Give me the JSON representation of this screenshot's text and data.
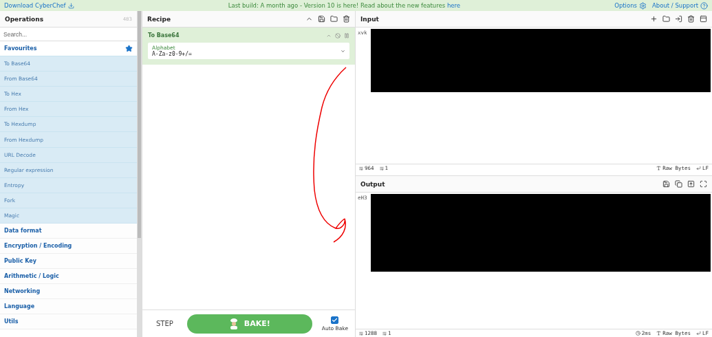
{
  "top_bar": {
    "download": "Download CyberChef",
    "notice": "Last build: A month ago - Version 10 is here! Read about the new features ",
    "notice_link": "here",
    "options": "Options",
    "about": "About / Support"
  },
  "operations": {
    "title": "Operations",
    "count": "483",
    "search_placeholder": "Search...",
    "categories": [
      {
        "name": "Favourites",
        "expanded": true,
        "items": [
          "To Base64",
          "From Base64",
          "To Hex",
          "From Hex",
          "To Hexdump",
          "From Hexdump",
          "URL Decode",
          "Regular expression",
          "Entropy",
          "Fork",
          "Magic"
        ]
      },
      {
        "name": "Data format",
        "expanded": false
      },
      {
        "name": "Encryption / Encoding",
        "expanded": false
      },
      {
        "name": "Public Key",
        "expanded": false
      },
      {
        "name": "Arithmetic / Logic",
        "expanded": false
      },
      {
        "name": "Networking",
        "expanded": false
      },
      {
        "name": "Language",
        "expanded": false
      },
      {
        "name": "Utils",
        "expanded": false
      }
    ]
  },
  "recipe": {
    "title": "Recipe",
    "operation": {
      "name": "To Base64",
      "field_label": "Alphabet",
      "field_value": "A-Za-z0-9+/="
    },
    "step": "STEP",
    "bake": "BAKE!",
    "auto_bake": {
      "label": "Auto Bake",
      "checked": true
    }
  },
  "input": {
    "title": "Input",
    "value": "xvk",
    "status": {
      "length": "964",
      "lines": "1",
      "encoding": "Raw Bytes",
      "eol": "LF"
    }
  },
  "output": {
    "title": "Output",
    "value": "eH3",
    "status": {
      "length": "1288",
      "lines": "1",
      "time": "2ms",
      "encoding": "Raw Bytes",
      "eol": "LF"
    }
  }
}
